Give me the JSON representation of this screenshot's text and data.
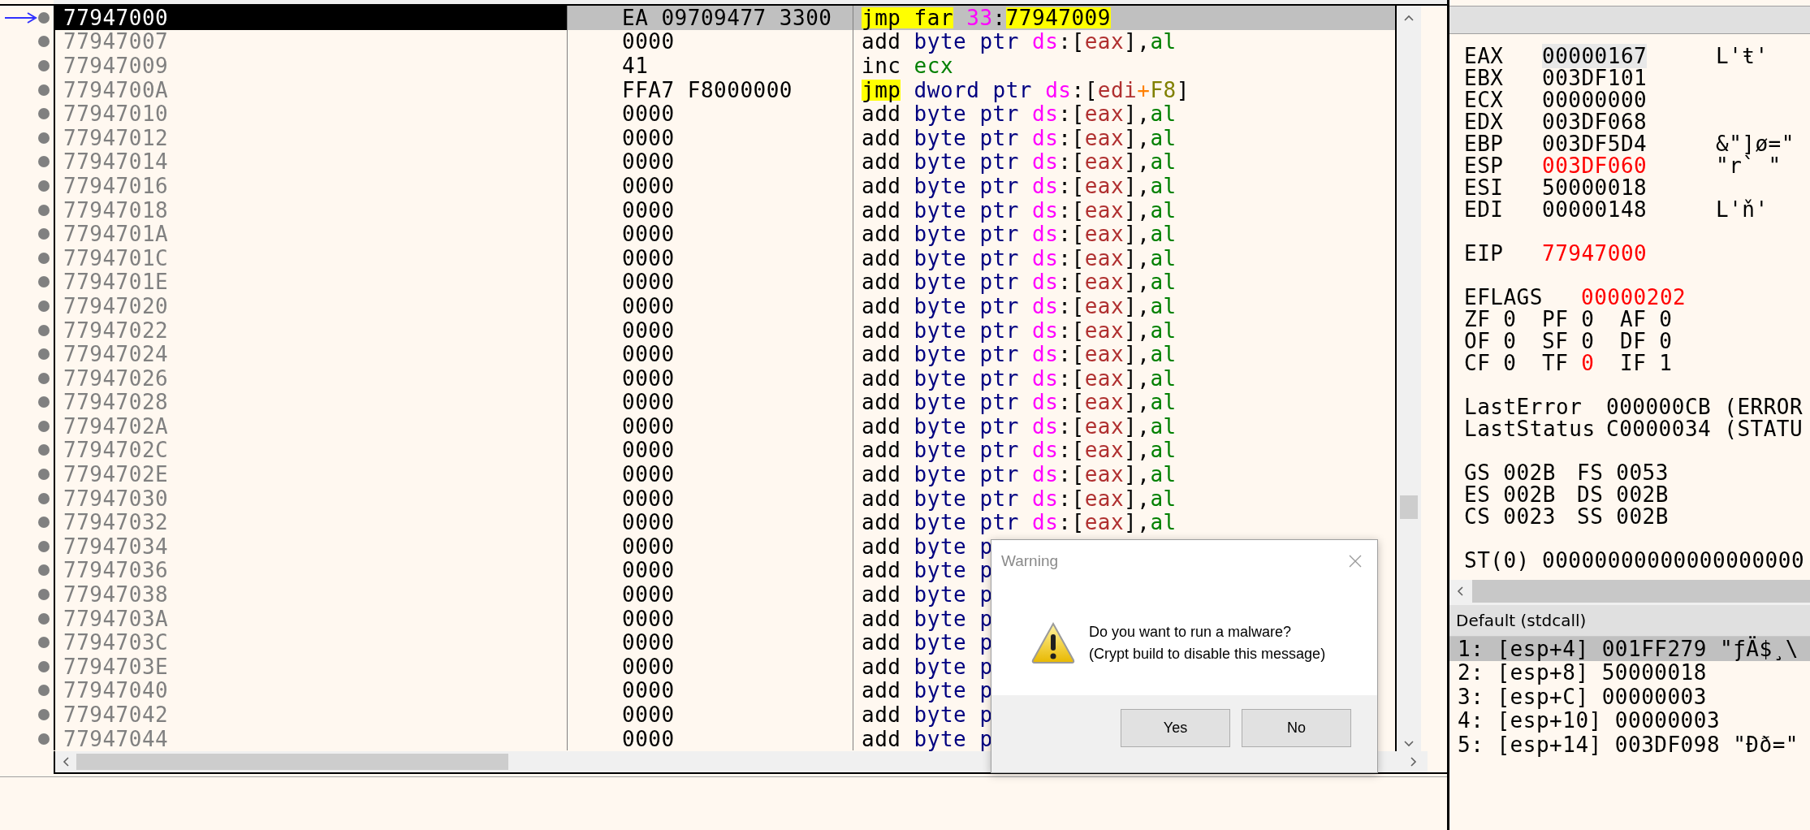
{
  "disassembly": {
    "rows": [
      {
        "address": "77947000",
        "bytes": "EA 09709477 3300",
        "instruction": [
          {
            "text": "jmp far",
            "kind": "jump"
          },
          {
            "text": " 33",
            "kind": "segment"
          },
          {
            "text": ":",
            "kind": "punct"
          },
          {
            "text": "77947009",
            "kind": "target"
          }
        ],
        "selected": true,
        "eip": true
      },
      {
        "address": "77947007",
        "bytes": "0000",
        "instruction": [
          {
            "text": "add",
            "kind": "op"
          },
          {
            "text": " byte ptr",
            "kind": "size"
          },
          {
            "text": " ds",
            "kind": "segment"
          },
          {
            "text": ":[",
            "kind": "punct"
          },
          {
            "text": "eax",
            "kind": "memreg"
          },
          {
            "text": "],",
            "kind": "punct"
          },
          {
            "text": "al",
            "kind": "reg"
          }
        ],
        "selected": false,
        "eip": false
      },
      {
        "address": "77947009",
        "bytes": "41",
        "instruction": [
          {
            "text": "inc",
            "kind": "op"
          },
          {
            "text": " ecx",
            "kind": "reg"
          }
        ],
        "selected": false,
        "eip": false
      },
      {
        "address": "7794700A",
        "bytes": "FFA7 F8000000",
        "instruction": [
          {
            "text": "jmp",
            "kind": "jump"
          },
          {
            "text": " dword ptr",
            "kind": "size"
          },
          {
            "text": " ds",
            "kind": "segment"
          },
          {
            "text": ":[",
            "kind": "punct"
          },
          {
            "text": "edi",
            "kind": "memreg"
          },
          {
            "text": "+",
            "kind": "plus"
          },
          {
            "text": "F8",
            "kind": "imm"
          },
          {
            "text": "]",
            "kind": "punct"
          }
        ],
        "selected": false,
        "eip": false
      },
      {
        "address": "77947010",
        "bytes": "0000",
        "instruction": [
          {
            "text": "add",
            "kind": "op"
          },
          {
            "text": " byte ptr",
            "kind": "size"
          },
          {
            "text": " ds",
            "kind": "segment"
          },
          {
            "text": ":[",
            "kind": "punct"
          },
          {
            "text": "eax",
            "kind": "memreg"
          },
          {
            "text": "],",
            "kind": "punct"
          },
          {
            "text": "al",
            "kind": "reg"
          }
        ],
        "selected": false,
        "eip": false
      },
      {
        "address": "77947012",
        "bytes": "0000",
        "instruction": [
          {
            "text": "add",
            "kind": "op"
          },
          {
            "text": " byte ptr",
            "kind": "size"
          },
          {
            "text": " ds",
            "kind": "segment"
          },
          {
            "text": ":[",
            "kind": "punct"
          },
          {
            "text": "eax",
            "kind": "memreg"
          },
          {
            "text": "],",
            "kind": "punct"
          },
          {
            "text": "al",
            "kind": "reg"
          }
        ],
        "selected": false,
        "eip": false
      },
      {
        "address": "77947014",
        "bytes": "0000",
        "instruction": [
          {
            "text": "add",
            "kind": "op"
          },
          {
            "text": " byte ptr",
            "kind": "size"
          },
          {
            "text": " ds",
            "kind": "segment"
          },
          {
            "text": ":[",
            "kind": "punct"
          },
          {
            "text": "eax",
            "kind": "memreg"
          },
          {
            "text": "],",
            "kind": "punct"
          },
          {
            "text": "al",
            "kind": "reg"
          }
        ],
        "selected": false,
        "eip": false
      },
      {
        "address": "77947016",
        "bytes": "0000",
        "instruction": [
          {
            "text": "add",
            "kind": "op"
          },
          {
            "text": " byte ptr",
            "kind": "size"
          },
          {
            "text": " ds",
            "kind": "segment"
          },
          {
            "text": ":[",
            "kind": "punct"
          },
          {
            "text": "eax",
            "kind": "memreg"
          },
          {
            "text": "],",
            "kind": "punct"
          },
          {
            "text": "al",
            "kind": "reg"
          }
        ],
        "selected": false,
        "eip": false
      },
      {
        "address": "77947018",
        "bytes": "0000",
        "instruction": [
          {
            "text": "add",
            "kind": "op"
          },
          {
            "text": " byte ptr",
            "kind": "size"
          },
          {
            "text": " ds",
            "kind": "segment"
          },
          {
            "text": ":[",
            "kind": "punct"
          },
          {
            "text": "eax",
            "kind": "memreg"
          },
          {
            "text": "],",
            "kind": "punct"
          },
          {
            "text": "al",
            "kind": "reg"
          }
        ],
        "selected": false,
        "eip": false
      },
      {
        "address": "7794701A",
        "bytes": "0000",
        "instruction": [
          {
            "text": "add",
            "kind": "op"
          },
          {
            "text": " byte ptr",
            "kind": "size"
          },
          {
            "text": " ds",
            "kind": "segment"
          },
          {
            "text": ":[",
            "kind": "punct"
          },
          {
            "text": "eax",
            "kind": "memreg"
          },
          {
            "text": "],",
            "kind": "punct"
          },
          {
            "text": "al",
            "kind": "reg"
          }
        ],
        "selected": false,
        "eip": false
      },
      {
        "address": "7794701C",
        "bytes": "0000",
        "instruction": [
          {
            "text": "add",
            "kind": "op"
          },
          {
            "text": " byte ptr",
            "kind": "size"
          },
          {
            "text": " ds",
            "kind": "segment"
          },
          {
            "text": ":[",
            "kind": "punct"
          },
          {
            "text": "eax",
            "kind": "memreg"
          },
          {
            "text": "],",
            "kind": "punct"
          },
          {
            "text": "al",
            "kind": "reg"
          }
        ],
        "selected": false,
        "eip": false
      },
      {
        "address": "7794701E",
        "bytes": "0000",
        "instruction": [
          {
            "text": "add",
            "kind": "op"
          },
          {
            "text": " byte ptr",
            "kind": "size"
          },
          {
            "text": " ds",
            "kind": "segment"
          },
          {
            "text": ":[",
            "kind": "punct"
          },
          {
            "text": "eax",
            "kind": "memreg"
          },
          {
            "text": "],",
            "kind": "punct"
          },
          {
            "text": "al",
            "kind": "reg"
          }
        ],
        "selected": false,
        "eip": false
      },
      {
        "address": "77947020",
        "bytes": "0000",
        "instruction": [
          {
            "text": "add",
            "kind": "op"
          },
          {
            "text": " byte ptr",
            "kind": "size"
          },
          {
            "text": " ds",
            "kind": "segment"
          },
          {
            "text": ":[",
            "kind": "punct"
          },
          {
            "text": "eax",
            "kind": "memreg"
          },
          {
            "text": "],",
            "kind": "punct"
          },
          {
            "text": "al",
            "kind": "reg"
          }
        ],
        "selected": false,
        "eip": false
      },
      {
        "address": "77947022",
        "bytes": "0000",
        "instruction": [
          {
            "text": "add",
            "kind": "op"
          },
          {
            "text": " byte ptr",
            "kind": "size"
          },
          {
            "text": " ds",
            "kind": "segment"
          },
          {
            "text": ":[",
            "kind": "punct"
          },
          {
            "text": "eax",
            "kind": "memreg"
          },
          {
            "text": "],",
            "kind": "punct"
          },
          {
            "text": "al",
            "kind": "reg"
          }
        ],
        "selected": false,
        "eip": false
      },
      {
        "address": "77947024",
        "bytes": "0000",
        "instruction": [
          {
            "text": "add",
            "kind": "op"
          },
          {
            "text": " byte ptr",
            "kind": "size"
          },
          {
            "text": " ds",
            "kind": "segment"
          },
          {
            "text": ":[",
            "kind": "punct"
          },
          {
            "text": "eax",
            "kind": "memreg"
          },
          {
            "text": "],",
            "kind": "punct"
          },
          {
            "text": "al",
            "kind": "reg"
          }
        ],
        "selected": false,
        "eip": false
      },
      {
        "address": "77947026",
        "bytes": "0000",
        "instruction": [
          {
            "text": "add",
            "kind": "op"
          },
          {
            "text": " byte ptr",
            "kind": "size"
          },
          {
            "text": " ds",
            "kind": "segment"
          },
          {
            "text": ":[",
            "kind": "punct"
          },
          {
            "text": "eax",
            "kind": "memreg"
          },
          {
            "text": "],",
            "kind": "punct"
          },
          {
            "text": "al",
            "kind": "reg"
          }
        ],
        "selected": false,
        "eip": false
      },
      {
        "address": "77947028",
        "bytes": "0000",
        "instruction": [
          {
            "text": "add",
            "kind": "op"
          },
          {
            "text": " byte ptr",
            "kind": "size"
          },
          {
            "text": " ds",
            "kind": "segment"
          },
          {
            "text": ":[",
            "kind": "punct"
          },
          {
            "text": "eax",
            "kind": "memreg"
          },
          {
            "text": "],",
            "kind": "punct"
          },
          {
            "text": "al",
            "kind": "reg"
          }
        ],
        "selected": false,
        "eip": false
      },
      {
        "address": "7794702A",
        "bytes": "0000",
        "instruction": [
          {
            "text": "add",
            "kind": "op"
          },
          {
            "text": " byte ptr",
            "kind": "size"
          },
          {
            "text": " ds",
            "kind": "segment"
          },
          {
            "text": ":[",
            "kind": "punct"
          },
          {
            "text": "eax",
            "kind": "memreg"
          },
          {
            "text": "],",
            "kind": "punct"
          },
          {
            "text": "al",
            "kind": "reg"
          }
        ],
        "selected": false,
        "eip": false
      },
      {
        "address": "7794702C",
        "bytes": "0000",
        "instruction": [
          {
            "text": "add",
            "kind": "op"
          },
          {
            "text": " byte ptr",
            "kind": "size"
          },
          {
            "text": " ds",
            "kind": "segment"
          },
          {
            "text": ":[",
            "kind": "punct"
          },
          {
            "text": "eax",
            "kind": "memreg"
          },
          {
            "text": "],",
            "kind": "punct"
          },
          {
            "text": "al",
            "kind": "reg"
          }
        ],
        "selected": false,
        "eip": false
      },
      {
        "address": "7794702E",
        "bytes": "0000",
        "instruction": [
          {
            "text": "add",
            "kind": "op"
          },
          {
            "text": " byte ptr",
            "kind": "size"
          },
          {
            "text": " ds",
            "kind": "segment"
          },
          {
            "text": ":[",
            "kind": "punct"
          },
          {
            "text": "eax",
            "kind": "memreg"
          },
          {
            "text": "],",
            "kind": "punct"
          },
          {
            "text": "al",
            "kind": "reg"
          }
        ],
        "selected": false,
        "eip": false
      },
      {
        "address": "77947030",
        "bytes": "0000",
        "instruction": [
          {
            "text": "add",
            "kind": "op"
          },
          {
            "text": " byte ptr",
            "kind": "size"
          },
          {
            "text": " ds",
            "kind": "segment"
          },
          {
            "text": ":[",
            "kind": "punct"
          },
          {
            "text": "eax",
            "kind": "memreg"
          },
          {
            "text": "],",
            "kind": "punct"
          },
          {
            "text": "al",
            "kind": "reg"
          }
        ],
        "selected": false,
        "eip": false
      },
      {
        "address": "77947032",
        "bytes": "0000",
        "instruction": [
          {
            "text": "add",
            "kind": "op"
          },
          {
            "text": " byte ptr",
            "kind": "size"
          },
          {
            "text": " ds",
            "kind": "segment"
          },
          {
            "text": ":[",
            "kind": "punct"
          },
          {
            "text": "eax",
            "kind": "memreg"
          },
          {
            "text": "],",
            "kind": "punct"
          },
          {
            "text": "al",
            "kind": "reg"
          }
        ],
        "selected": false,
        "eip": false
      },
      {
        "address": "77947034",
        "bytes": "0000",
        "instruction": [
          {
            "text": "add",
            "kind": "op"
          },
          {
            "text": " byte p",
            "kind": "size"
          }
        ],
        "selected": false,
        "eip": false
      },
      {
        "address": "77947036",
        "bytes": "0000",
        "instruction": [
          {
            "text": "add",
            "kind": "op"
          },
          {
            "text": " byte p",
            "kind": "size"
          }
        ],
        "selected": false,
        "eip": false
      },
      {
        "address": "77947038",
        "bytes": "0000",
        "instruction": [
          {
            "text": "add",
            "kind": "op"
          },
          {
            "text": " byte p",
            "kind": "size"
          }
        ],
        "selected": false,
        "eip": false
      },
      {
        "address": "7794703A",
        "bytes": "0000",
        "instruction": [
          {
            "text": "add",
            "kind": "op"
          },
          {
            "text": " byte p",
            "kind": "size"
          }
        ],
        "selected": false,
        "eip": false
      },
      {
        "address": "7794703C",
        "bytes": "0000",
        "instruction": [
          {
            "text": "add",
            "kind": "op"
          },
          {
            "text": " byte p",
            "kind": "size"
          }
        ],
        "selected": false,
        "eip": false
      },
      {
        "address": "7794703E",
        "bytes": "0000",
        "instruction": [
          {
            "text": "add",
            "kind": "op"
          },
          {
            "text": " byte p",
            "kind": "size"
          }
        ],
        "selected": false,
        "eip": false
      },
      {
        "address": "77947040",
        "bytes": "0000",
        "instruction": [
          {
            "text": "add",
            "kind": "op"
          },
          {
            "text": " byte p",
            "kind": "size"
          }
        ],
        "selected": false,
        "eip": false
      },
      {
        "address": "77947042",
        "bytes": "0000",
        "instruction": [
          {
            "text": "add",
            "kind": "op"
          },
          {
            "text": " byte p",
            "kind": "size"
          }
        ],
        "selected": false,
        "eip": false
      },
      {
        "address": "77947044",
        "bytes": "0000",
        "instruction": [
          {
            "text": "add",
            "kind": "op"
          },
          {
            "text": " byte p",
            "kind": "size"
          }
        ],
        "selected": false,
        "eip": false
      }
    ]
  },
  "registers": {
    "general": [
      {
        "name": "EAX",
        "value": "00000167",
        "comment": "L'ŧ'",
        "changed": false,
        "selected": true
      },
      {
        "name": "EBX",
        "value": "003DF101",
        "changed": false,
        "selected": false
      },
      {
        "name": "ECX",
        "value": "00000000",
        "changed": false,
        "selected": false
      },
      {
        "name": "EDX",
        "value": "003DF068",
        "changed": false,
        "selected": false
      },
      {
        "name": "EBP",
        "value": "003DF5D4",
        "comment": "&\"]ø=\"",
        "changed": false,
        "selected": false
      },
      {
        "name": "ESP",
        "value": "003DF060",
        "comment": "\"r` \"",
        "changed": true,
        "selected": false
      },
      {
        "name": "ESI",
        "value": "50000018",
        "changed": false,
        "selected": false
      },
      {
        "name": "EDI",
        "value": "00000148",
        "comment": "L'ň'",
        "changed": false,
        "selected": false
      }
    ],
    "eip": {
      "name": "EIP",
      "value": "77947000",
      "changed": true
    },
    "eflags": {
      "name": "EFLAGS",
      "value": "00000202",
      "changed": true
    },
    "flags": [
      {
        "name": "ZF",
        "value": "0",
        "changed": false
      },
      {
        "name": "PF",
        "value": "0",
        "changed": false
      },
      {
        "name": "AF",
        "value": "0",
        "changed": false
      },
      {
        "name": "OF",
        "value": "0",
        "changed": false
      },
      {
        "name": "SF",
        "value": "0",
        "changed": false
      },
      {
        "name": "DF",
        "value": "0",
        "changed": false
      },
      {
        "name": "CF",
        "value": "0",
        "changed": false
      },
      {
        "name": "TF",
        "value": "0",
        "changed": true
      },
      {
        "name": "IF",
        "value": "1",
        "changed": false
      }
    ],
    "last_error": {
      "label": "LastError",
      "value": "000000CB",
      "comment": "(ERROR"
    },
    "last_status": {
      "label": "LastStatus",
      "value": "C0000034",
      "comment": "(STATU"
    },
    "segments": [
      {
        "name": "GS",
        "value": "002B"
      },
      {
        "name": "FS",
        "value": "0053"
      },
      {
        "name": "ES",
        "value": "002B"
      },
      {
        "name": "DS",
        "value": "002B"
      },
      {
        "name": "CS",
        "value": "0023"
      },
      {
        "name": "SS",
        "value": "002B"
      }
    ],
    "fpu": {
      "name": "ST(0)",
      "value": "00000000000000000000"
    }
  },
  "arguments": {
    "convention": "Default (stdcall)",
    "rows": [
      {
        "index": "1:",
        "location": "[esp+4]",
        "value": "001FF279",
        "comment": "\"ƒÄ$¸\\",
        "selected": true
      },
      {
        "index": "2:",
        "location": "[esp+8]",
        "value": "50000018",
        "selected": false
      },
      {
        "index": "3:",
        "location": "[esp+C]",
        "value": "00000003",
        "selected": false
      },
      {
        "index": "4:",
        "location": "[esp+10]",
        "value": "00000003",
        "selected": false
      },
      {
        "index": "5:",
        "location": "[esp+14]",
        "value": "003DF098",
        "comment": "\"Ðð=\"",
        "selected": false
      }
    ]
  },
  "dialog": {
    "title": "Warning",
    "message": [
      "Do you want to run a malware?",
      "(Crypt build to disable this message)"
    ],
    "buttons": [
      "Yes",
      "No"
    ]
  }
}
